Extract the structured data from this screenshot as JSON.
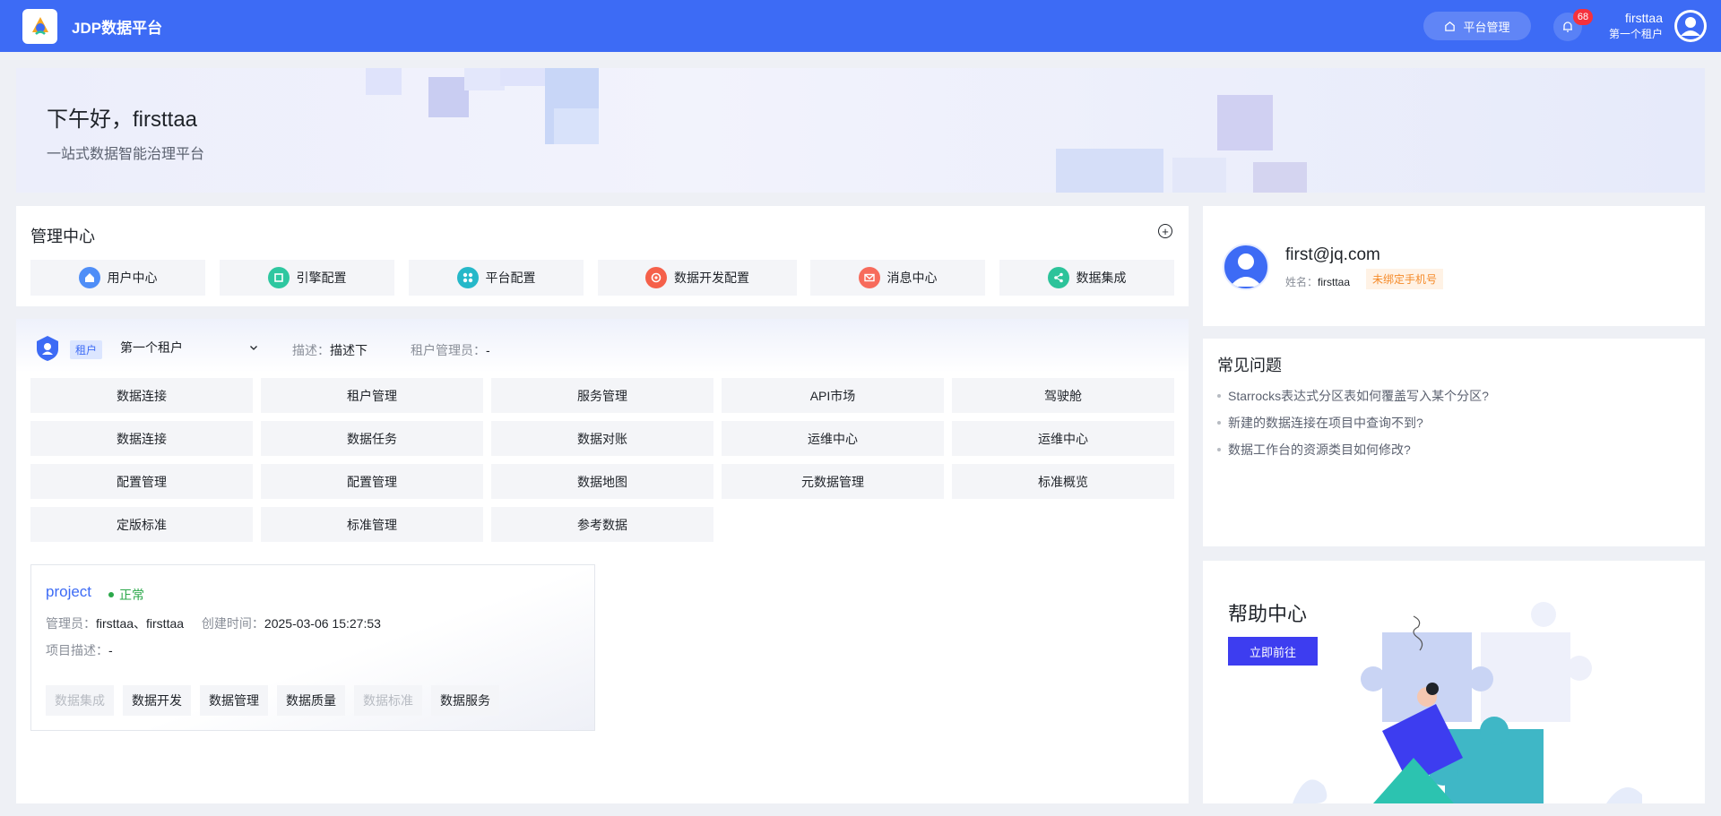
{
  "header": {
    "app_title": "JDP数据平台",
    "platform_btn": "平台管理",
    "notification_count": "68",
    "user_name": "firsttaa",
    "tenant_name": "第一个租户"
  },
  "banner": {
    "greeting": "下午好，firsttaa",
    "subtitle": "一站式数据智能治理平台"
  },
  "management": {
    "title": "管理中心",
    "items": [
      {
        "label": "用户中心",
        "color": "#4f8ef7",
        "icon": "user-icon"
      },
      {
        "label": "引擎配置",
        "color": "#2ec7a0",
        "icon": "engine-icon"
      },
      {
        "label": "平台配置",
        "color": "#26b8c9",
        "icon": "grid-icon"
      },
      {
        "label": "数据开发配置",
        "color": "#f5604a",
        "icon": "target-icon"
      },
      {
        "label": "消息中心",
        "color": "#f76b5c",
        "icon": "mail-icon"
      },
      {
        "label": "数据集成",
        "color": "#2cc39a",
        "icon": "share-icon"
      }
    ]
  },
  "tenant": {
    "tag": "租户",
    "selected": "第一个租户",
    "desc_label": "描述：",
    "desc_value": "描述下",
    "admin_label": "租户管理员：",
    "admin_value": "-",
    "modules": [
      [
        "数据连接",
        "租户管理",
        "服务管理",
        "API市场",
        "驾驶舱"
      ],
      [
        "数据连接",
        "数据任务",
        "数据对账",
        "运维中心",
        "运维中心"
      ],
      [
        "配置管理",
        "配置管理",
        "数据地图",
        "元数据管理",
        "标准概览"
      ],
      [
        "定版标准",
        "标准管理",
        "参考数据"
      ]
    ]
  },
  "project": {
    "name": "project",
    "status": "正常",
    "admin_label": "管理员：",
    "admin_value": "firsttaa、firsttaa",
    "created_label": "创建时间：",
    "created_value": "2025-03-06 15:27:53",
    "desc_label": "项目描述：",
    "desc_value": "-",
    "buttons": [
      {
        "label": "数据集成",
        "disabled": true
      },
      {
        "label": "数据开发",
        "disabled": false
      },
      {
        "label": "数据管理",
        "disabled": false
      },
      {
        "label": "数据质量",
        "disabled": false
      },
      {
        "label": "数据标准",
        "disabled": true
      },
      {
        "label": "数据服务",
        "disabled": false
      }
    ]
  },
  "profile": {
    "email": "first@jq.com",
    "name_label": "姓名：",
    "name_value": "firsttaa",
    "phone_tag": "未绑定手机号"
  },
  "faq": {
    "title": "常见问题",
    "items": [
      "Starrocks表达式分区表如何覆盖写入某个分区?",
      "新建的数据连接在项目中查询不到?",
      "数据工作台的资源类目如何修改?"
    ]
  },
  "help": {
    "title": "帮助中心",
    "button": "立即前往"
  }
}
